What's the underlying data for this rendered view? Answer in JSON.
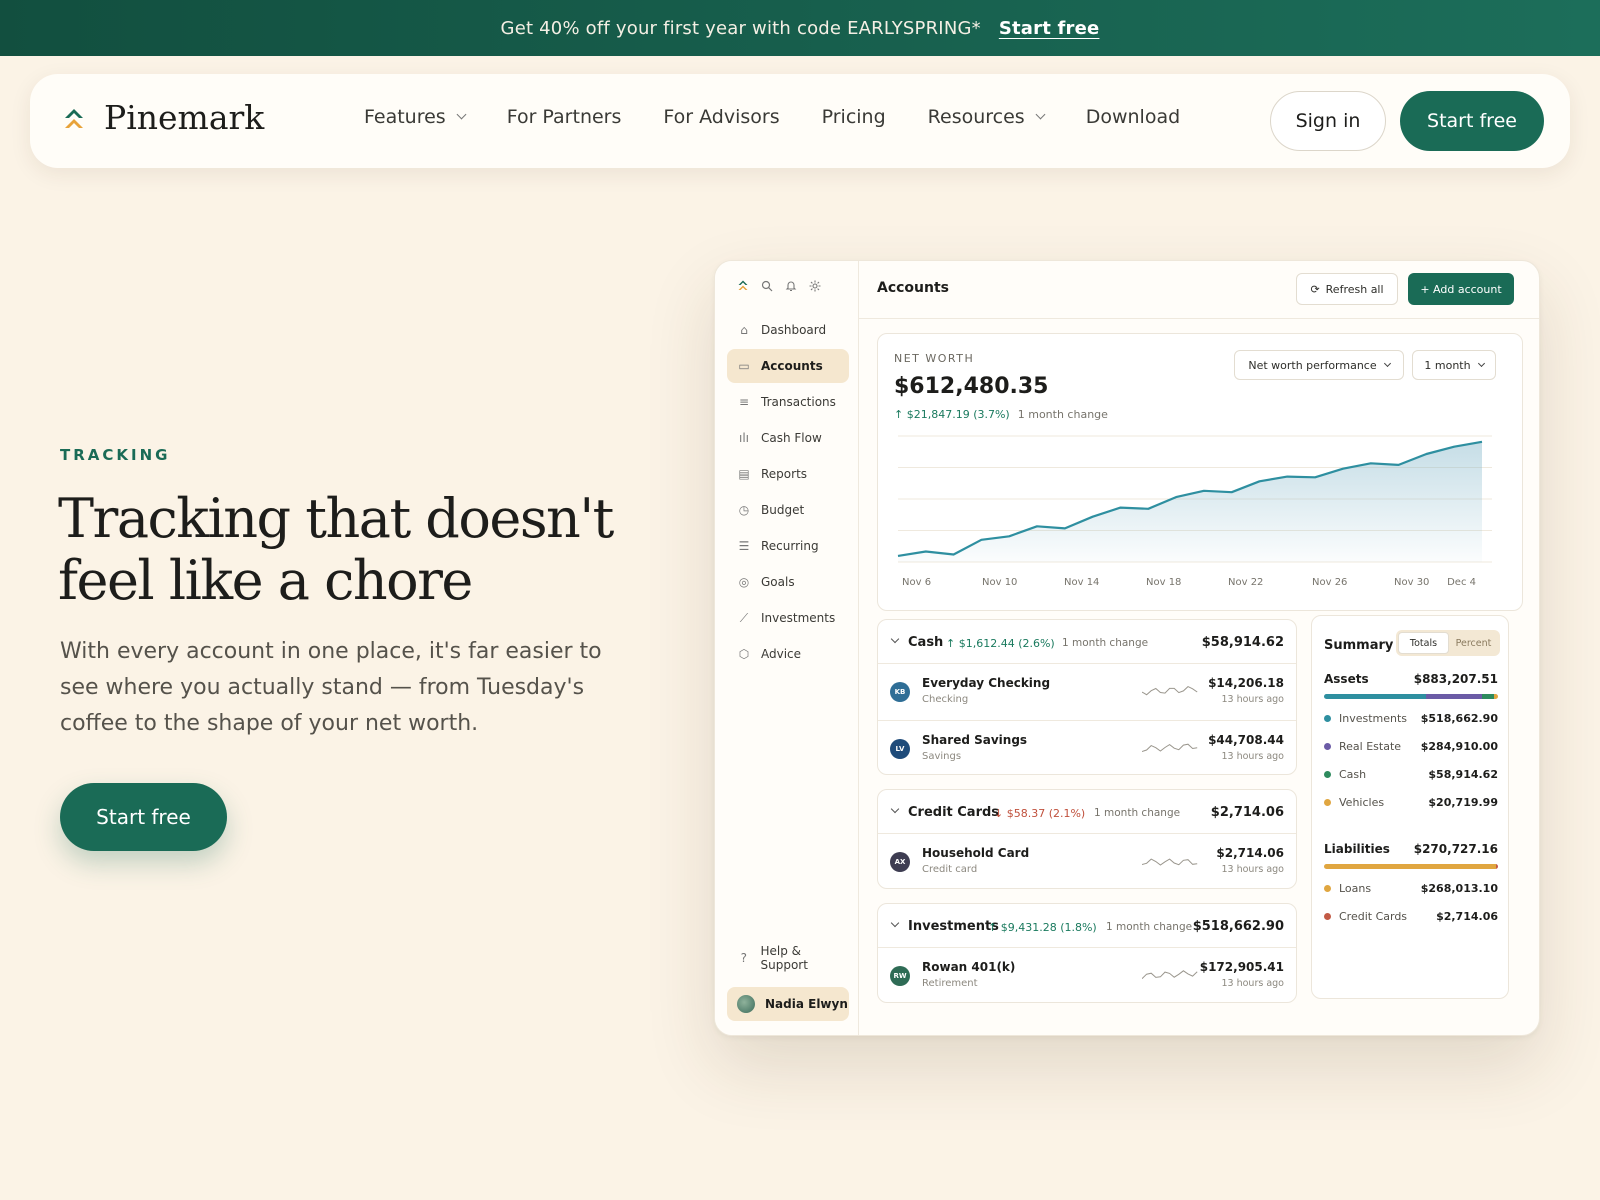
{
  "promo": {
    "text": "Get 40% off your first year with code EARLYSPRING*",
    "link": "Start free"
  },
  "nav": {
    "brand": "Pinemark",
    "links": [
      "Features",
      "For Partners",
      "For Advisors",
      "Pricing",
      "Resources",
      "Download"
    ],
    "sign_in": "Sign in",
    "start_free": "Start free"
  },
  "hero": {
    "eyebrow": "TRACKING",
    "headline": "Tracking that doesn't feel like a chore",
    "subcopy": "With every account in one place, it's far easier to see where you actually stand — from Tuesday's coffee to the shape of your net worth.",
    "cta": "Start free"
  },
  "app": {
    "sidebar": {
      "items": [
        "Dashboard",
        "Accounts",
        "Transactions",
        "Cash Flow",
        "Reports",
        "Budget",
        "Recurring",
        "Goals",
        "Investments",
        "Advice"
      ],
      "active_index": 1,
      "help": "Help & Support",
      "user": "Nadia Elwyn"
    },
    "header": {
      "title": "Accounts",
      "refresh": "Refresh all",
      "add": "+ Add account"
    },
    "net_worth": {
      "label": "NET WORTH",
      "value": "$612,480.35",
      "change": "↑ $21,847.19 (3.7%)",
      "change_note": "1 month change",
      "select_metric": "Net worth performance",
      "select_range": "1 month"
    },
    "groups": [
      {
        "name": "Cash",
        "change": "↑ $1,612.44 (2.6%)",
        "change_dir": "up",
        "note": "1 month change",
        "total": "$58,914.62",
        "accounts": [
          {
            "initials": "KB",
            "color": "#2F6E96",
            "name": "Everyday Checking",
            "type": "Checking",
            "value": "$14,206.18",
            "time": "13 hours ago"
          },
          {
            "initials": "LV",
            "color": "#1E4B7A",
            "name": "Shared Savings",
            "type": "Savings",
            "value": "$44,708.44",
            "time": "13 hours ago"
          }
        ]
      },
      {
        "name": "Credit Cards",
        "change": "↓ $58.37 (2.1%)",
        "change_dir": "down",
        "note": "1 month change",
        "total": "$2,714.06",
        "accounts": [
          {
            "initials": "AX",
            "color": "#3E3D52",
            "name": "Household Card",
            "type": "Credit card",
            "value": "$2,714.06",
            "time": "13 hours ago"
          }
        ]
      },
      {
        "name": "Investments",
        "change": "↑ $9,431.28 (1.8%)",
        "change_dir": "up",
        "note": "1 month change",
        "total": "$518,662.90",
        "accounts": [
          {
            "initials": "RW",
            "color": "#2E6B55",
            "name": "Rowan 401(k)",
            "type": "Retirement",
            "value": "$172,905.41",
            "time": "13 hours ago"
          }
        ]
      }
    ],
    "summary": {
      "title": "Summary",
      "toggle": [
        "Totals",
        "Percent"
      ],
      "assets": {
        "label": "Assets",
        "total": "$883,207.51",
        "items": [
          {
            "name": "Investments",
            "value": "$518,662.90",
            "color": "#2E8FA0",
            "share": 0.587
          },
          {
            "name": "Real Estate",
            "value": "$284,910.00",
            "color": "#6B5BA6",
            "share": 0.323
          },
          {
            "name": "Cash",
            "value": "$58,914.62",
            "color": "#2E8B5E",
            "share": 0.067
          },
          {
            "name": "Vehicles",
            "value": "$20,719.99",
            "color": "#E0A640",
            "share": 0.023
          }
        ]
      },
      "liabilities": {
        "label": "Liabilities",
        "total": "$270,727.16",
        "items": [
          {
            "name": "Loans",
            "value": "$268,013.10",
            "color": "#E0A640",
            "share": 0.99
          },
          {
            "name": "Credit Cards",
            "value": "$2,714.06",
            "color": "#C25A45",
            "share": 0.01
          }
        ]
      }
    }
  },
  "chart_data": {
    "type": "area",
    "categories": [
      "Nov 6",
      "Nov 10",
      "Nov 14",
      "Nov 18",
      "Nov 22",
      "Nov 26",
      "Nov 30",
      "Dec 4"
    ],
    "x_index": [
      0,
      1,
      2,
      3,
      4,
      5,
      6,
      7,
      8,
      9,
      10,
      11,
      12,
      13,
      14,
      15,
      16,
      17,
      18,
      19,
      20,
      21
    ],
    "values": [
      590.6,
      592.5,
      591.2,
      597.5,
      599.0,
      603.3,
      602.4,
      607.4,
      611.3,
      610.8,
      615.8,
      618.5,
      617.9,
      622.6,
      624.6,
      624.3,
      628.0,
      630.3,
      629.6,
      634.3,
      637.4,
      639.5
    ],
    "grid": true,
    "color": "#2E8FA0"
  }
}
